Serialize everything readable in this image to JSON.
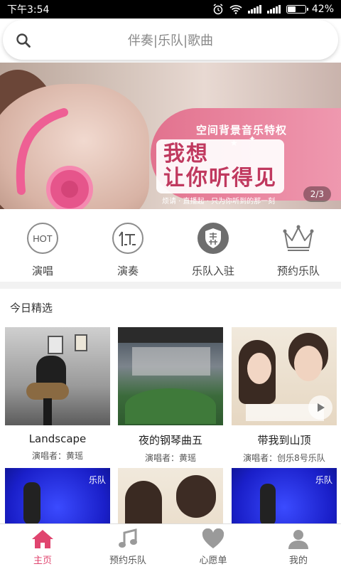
{
  "status_bar": {
    "time": "下午3:54",
    "battery": "42%",
    "battery_level": 0.42
  },
  "search": {
    "placeholder": "伴奏|乐队|歌曲"
  },
  "banner": {
    "subtitle": "空间背景音乐特权",
    "title_line1": "我想",
    "title_line2": "让你听得见",
    "caption": "烦请 · 直播起 · 只为你听到的那一刻",
    "indicator": "2/3"
  },
  "categories": [
    {
      "label": "演唱",
      "icon": "hot-icon"
    },
    {
      "label": "演奏",
      "icon": "you-badge-icon"
    },
    {
      "label": "乐队入驻",
      "icon": "jing-shield-icon"
    },
    {
      "label": "预约乐队",
      "icon": "crown-icon"
    }
  ],
  "section": {
    "title": "今日精选",
    "cards": [
      {
        "name": "Landscape",
        "singer": "演唱者：黄瑶"
      },
      {
        "name": "夜的钢琴曲五",
        "singer": "演唱者：黄瑶"
      },
      {
        "name": "带我到山顶",
        "singer": "演唱者：创乐8号乐队"
      },
      {
        "name": "",
        "singer": "",
        "overlay": "乐队"
      },
      {
        "name": "",
        "singer": ""
      },
      {
        "name": "",
        "singer": "",
        "overlay": "乐队"
      }
    ]
  },
  "tabs": [
    {
      "label": "主页",
      "icon": "home-icon",
      "active": true
    },
    {
      "label": "预约乐队",
      "icon": "music-note-icon",
      "active": false
    },
    {
      "label": "心愿单",
      "icon": "heart-icon",
      "active": false
    },
    {
      "label": "我的",
      "icon": "person-icon",
      "active": false
    }
  ],
  "colors": {
    "accent": "#e0456f",
    "icon_gray": "#9a9a9a"
  }
}
